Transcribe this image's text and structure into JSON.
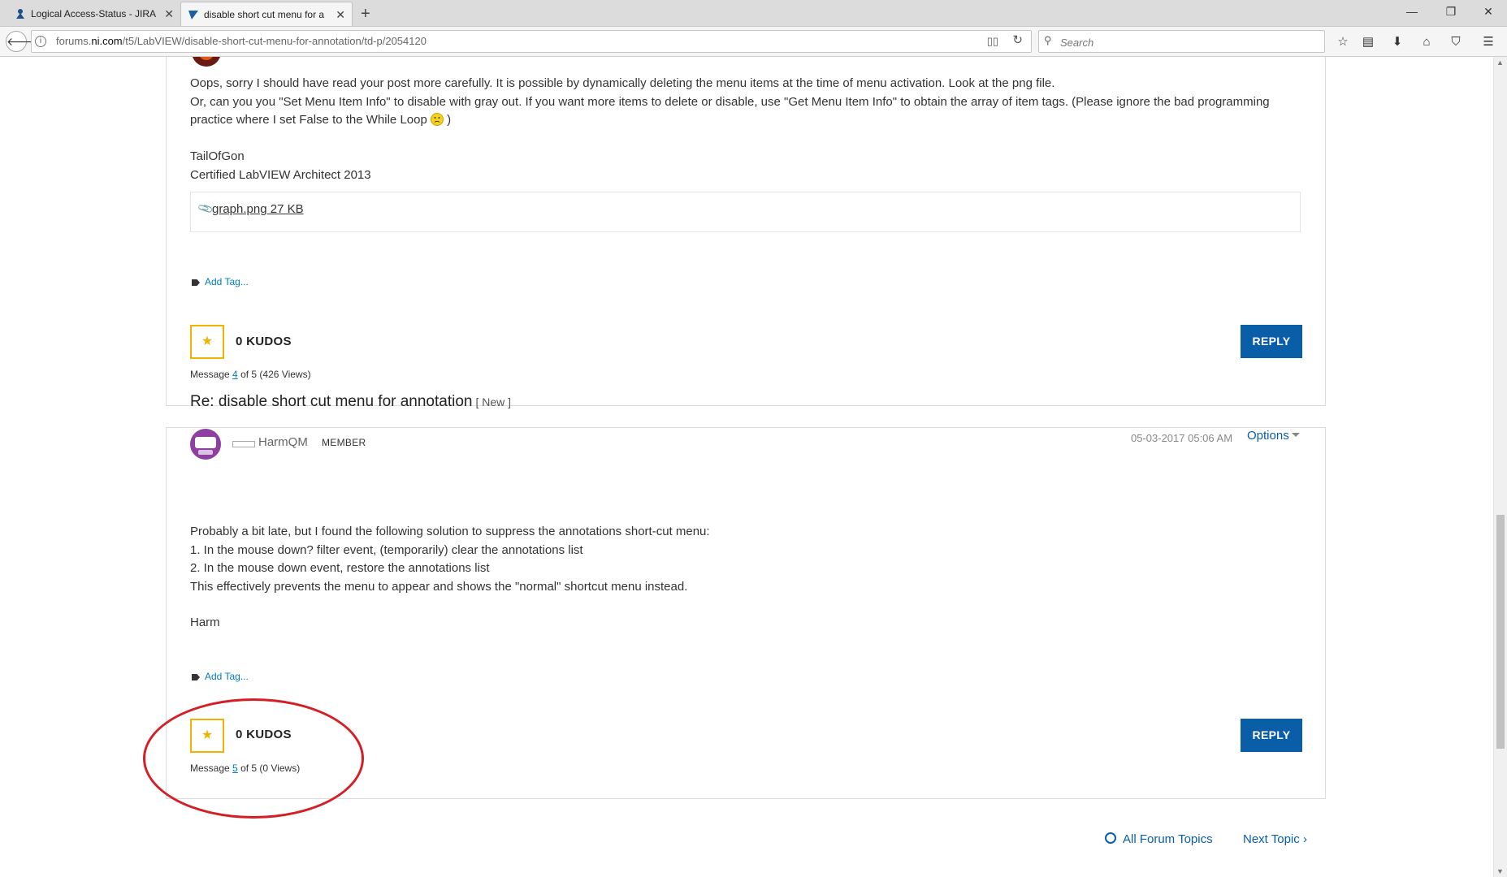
{
  "browser": {
    "tabs": [
      {
        "title": "Logical Access-Status - JIRA",
        "active": false
      },
      {
        "title": "disable short cut menu for a",
        "active": true
      }
    ],
    "url_prefix": "forums.",
    "url_domain": "ni.com",
    "url_path": "/t5/LabVIEW/disable-short-cut-menu-for-annotation/td-p/2054120",
    "search_placeholder": "Search"
  },
  "posts": [
    {
      "body_lines": [
        "Oops, sorry I should have read your post more carefully. It is possible by dynamically deleting the menu items at the time of menu activation. Look at the png file.",
        "Or, can you you \"Set Menu Item Info\" to disable with gray out. If you want more items to delete or disable, use \"Get Menu Item Info\" to obtain the array of item tags. (Please ignore the bad programming",
        "practice where I set False to the While Loop"
      ],
      "emoji_close": ")",
      "signature": [
        "TailOfGon",
        "Certified LabVIEW Architect 2013"
      ],
      "attachment": "graph.png 27 KB",
      "add_tag": "Add Tag...",
      "kudos": "0 KUDOS",
      "message_prefix": "Message",
      "message_num": "4",
      "message_suffix": "of 5 (426 Views)",
      "reply": "REPLY"
    },
    {
      "title": "Re: disable short cut menu for annotation",
      "badge": "[ New ]",
      "username": "HarmQM",
      "role": "MEMBER",
      "date": "05-03-2017 05:06 AM",
      "options": "Options",
      "body_lines": [
        "Probably a bit late, but I found the following solution to suppress the annotations short-cut menu:",
        "1. In the mouse down? filter event, (temporarily) clear the annotations list",
        "2. In the mouse down event, restore the annotations list",
        "This effectively prevents the menu to appear and shows the \"normal\" shortcut menu instead."
      ],
      "signature": "Harm",
      "add_tag": "Add Tag...",
      "kudos": "0 KUDOS",
      "message_prefix": "Message",
      "message_num": "5",
      "message_suffix": "of 5 (0 Views)",
      "reply": "REPLY"
    }
  ],
  "footer": {
    "all_topics": "All Forum Topics",
    "next_topic": "Next Topic"
  },
  "colors": {
    "accent": "#0a5ea8",
    "kudo": "#f0b400",
    "annotation_circle": "#d32027"
  }
}
